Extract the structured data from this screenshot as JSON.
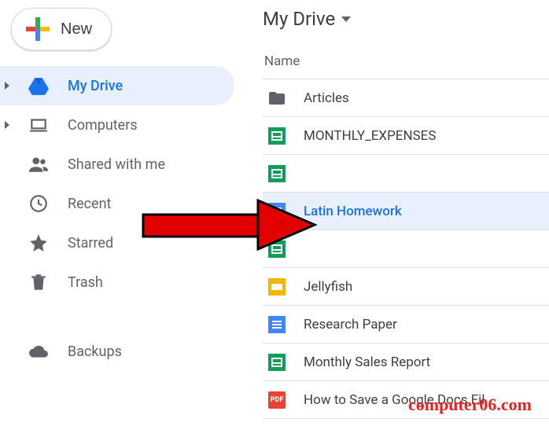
{
  "new_button": {
    "label": "New"
  },
  "sidebar": {
    "items": [
      {
        "label": "My Drive",
        "icon": "drive-icon",
        "selected": true,
        "expandable": true
      },
      {
        "label": "Computers",
        "icon": "computers-icon",
        "expandable": true
      },
      {
        "label": "Shared with me",
        "icon": "shared-icon"
      },
      {
        "label": "Recent",
        "icon": "recent-icon"
      },
      {
        "label": "Starred",
        "icon": "starred-icon"
      },
      {
        "label": "Trash",
        "icon": "trash-icon"
      }
    ],
    "backups_label": "Backups"
  },
  "breadcrumb": {
    "title": "My Drive"
  },
  "column_header": "Name",
  "files": [
    {
      "name": "Articles",
      "type": "folder"
    },
    {
      "name": "MONTHLY_EXPENSES",
      "type": "sheets"
    },
    {
      "name": "",
      "type": "sheets"
    },
    {
      "name": "Latin Homework",
      "type": "docs",
      "selected": true
    },
    {
      "name": "",
      "type": "sheets"
    },
    {
      "name": "Jellyfish",
      "type": "slides"
    },
    {
      "name": "Research Paper",
      "type": "docs"
    },
    {
      "name": "Monthly Sales Report",
      "type": "sheets"
    },
    {
      "name": "How to Save a Google Docs Fil",
      "type": "pdf"
    }
  ],
  "watermark": "computer06.com"
}
